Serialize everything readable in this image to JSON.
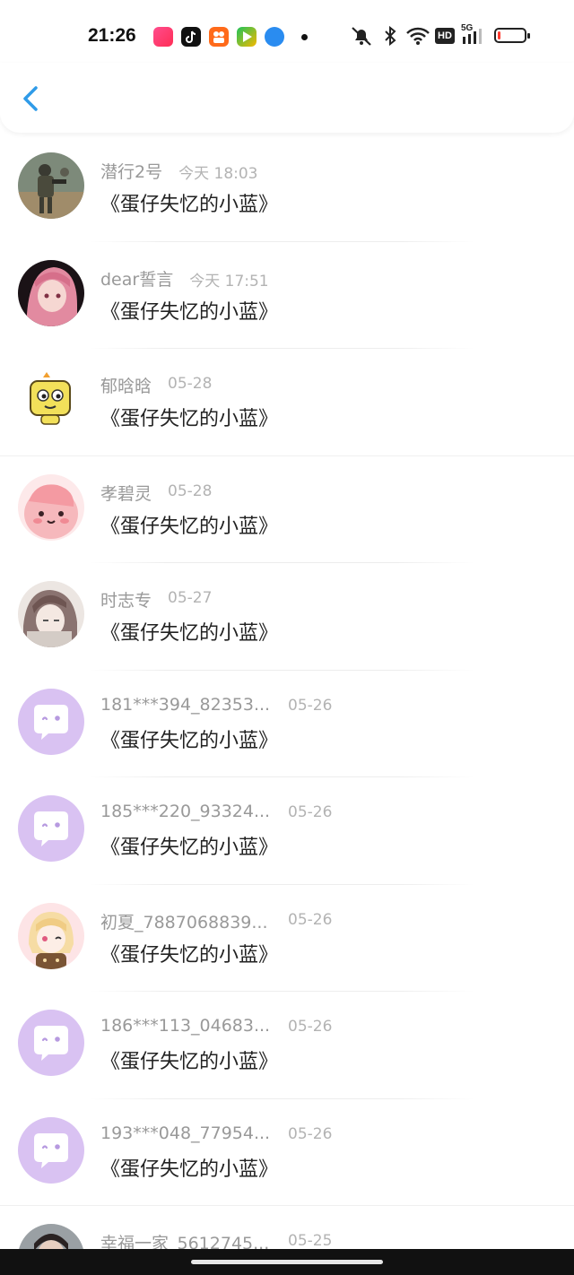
{
  "status_bar": {
    "time": "21:26",
    "apps": [
      "video-app-icon",
      "tiktok-icon",
      "kuaishou-icon",
      "game-app-icon",
      "browser-app-icon"
    ],
    "indicators": [
      "mute-icon",
      "bluetooth-icon",
      "wifi-icon",
      "hd-icon",
      "signal-5g-icon",
      "battery-icon"
    ],
    "network_label": "HD",
    "network_type": "5G",
    "battery_level": 0.1,
    "battery_color": "#ff3b30"
  },
  "nav": {
    "back_icon": "chevron-left-icon",
    "accent_color": "#2f9be8"
  },
  "items": [
    {
      "name": "潜行2号",
      "time": "今天 18:03",
      "message": "《蛋仔失忆的小蓝》",
      "avatar": "photo-soldier"
    },
    {
      "name": "dear誓言",
      "time": "今天 17:51",
      "message": "《蛋仔失忆的小蓝》",
      "avatar": "anime-pink-hair"
    },
    {
      "name": "郁晗晗",
      "time": "05-28",
      "message": "《蛋仔失忆的小蓝》",
      "avatar": "yellow-cartoon"
    },
    {
      "name": "孝碧灵",
      "time": "05-28",
      "message": "《蛋仔失忆的小蓝》",
      "avatar": "pink-blob"
    },
    {
      "name": "时志专",
      "time": "05-27",
      "message": "《蛋仔失忆的小蓝》",
      "avatar": "anime-sketch"
    },
    {
      "name": "181***394_82353...",
      "time": "05-26",
      "message": "《蛋仔失忆的小蓝》",
      "avatar": "default-chat"
    },
    {
      "name": "185***220_93324...",
      "time": "05-26",
      "message": "《蛋仔失忆的小蓝》",
      "avatar": "default-chat"
    },
    {
      "name": "初夏_7887068839...",
      "time": "05-26",
      "message": "《蛋仔失忆的小蓝》",
      "avatar": "anime-blonde"
    },
    {
      "name": "186***113_04683...",
      "time": "05-26",
      "message": "《蛋仔失忆的小蓝》",
      "avatar": "default-chat"
    },
    {
      "name": "193***048_77954...",
      "time": "05-26",
      "message": "《蛋仔失忆的小蓝》",
      "avatar": "default-chat"
    },
    {
      "name": "幸福一家_5612745...",
      "time": "05-25",
      "message": "",
      "avatar": "photo-person"
    }
  ],
  "colors": {
    "default_avatar_bg": "#d9c2f2",
    "name_text": "#999999",
    "message_text": "#222222"
  }
}
